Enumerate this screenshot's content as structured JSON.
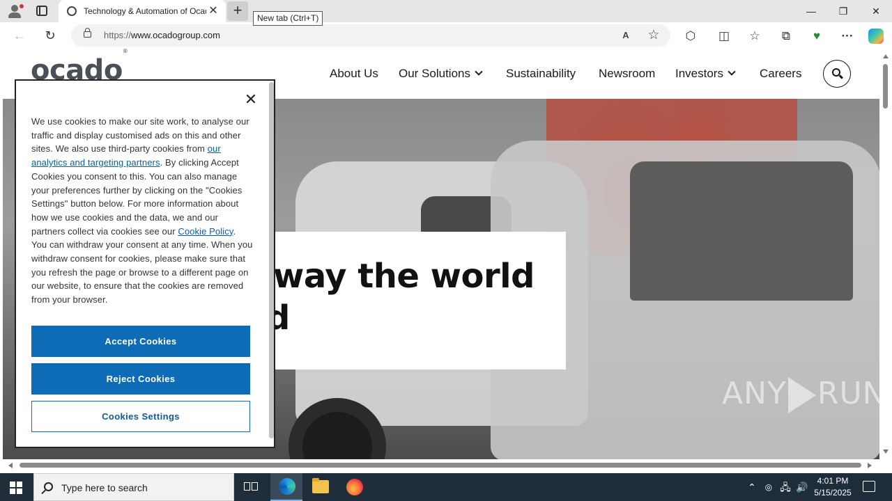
{
  "browser": {
    "tab_title": "Technology & Automation of Ocado Group",
    "tab_close": "✕",
    "new_tab_symbol": "+",
    "tooltip": "New tab (Ctrl+T)",
    "url_prefix": "https://",
    "url_host": "www.ocadogroup.com",
    "window_controls": {
      "minimize": "—",
      "restore": "❐",
      "close": "✕"
    },
    "nav": {
      "back": "←",
      "refresh": "↻"
    },
    "icons": {
      "read_aloud": "A",
      "favorite": "☆",
      "extensions": "⬡",
      "split": "◫",
      "favorites": "☆",
      "collections": "⧉",
      "performance": "♥",
      "more": "···"
    }
  },
  "site": {
    "logo": "ocado",
    "logo_mark": "®",
    "nav": [
      {
        "label": "About Us"
      },
      {
        "label": "Our Solutions",
        "has_dropdown": true
      },
      {
        "label": "Sustainability"
      },
      {
        "label": "Newsroom"
      },
      {
        "label": "Investors",
        "has_dropdown": true
      },
      {
        "label": "Careers"
      }
    ],
    "hero": {
      "line1": "way the world",
      "line2": "d"
    },
    "watermark": {
      "left": "ANY",
      "right": "RUN"
    }
  },
  "cookie_banner": {
    "close": "✕",
    "text_1": "We use cookies to make our site work, to analyse our traffic and display customised ads on this and other sites. We also use third-party cookies from ",
    "link_partners": "our analytics and targeting partners",
    "text_2": ". By clicking Accept Cookies you consent to this. You can also manage your preferences further by clicking on the \"Cookies Settings\" button below. For more information about how we use cookies and the data, we and our partners collect via cookies see our ",
    "link_policy": "Cookie Policy",
    "text_3": ". You can withdraw your consent at any time. When you withdraw consent for cookies, please make sure that you refresh the page or browse to a different page on our website, to ensure that the cookies are removed from your browser.",
    "accept": "Accept Cookies",
    "reject": "Reject Cookies",
    "settings": "Cookies Settings",
    "colors": {
      "button": "#0e6cb6",
      "link": "#0a5ea8"
    }
  },
  "taskbar": {
    "search_placeholder": "Type here to search",
    "time": "4:01 PM",
    "date": "5/15/2025",
    "tray": {
      "chevron": "⌃",
      "network": "🖧",
      "volume": "🔊"
    }
  }
}
